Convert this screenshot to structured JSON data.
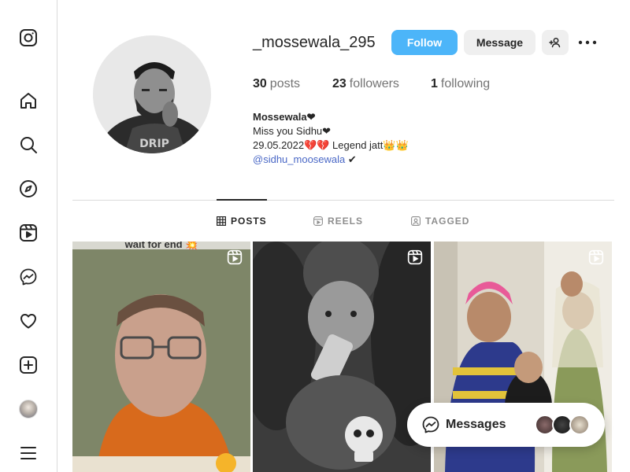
{
  "profile": {
    "username": "_mossewala_295",
    "follow_label": "Follow",
    "message_label": "Message",
    "stats": {
      "posts_count": "30",
      "posts_label": "posts",
      "followers_count": "23",
      "followers_label": "followers",
      "following_count": "1",
      "following_label": "following"
    },
    "bio": {
      "name": "Mossewala❤",
      "line1": "Miss you Sidhu❤",
      "line2": "29.05.2022💔💔 Legend jatt👑👑",
      "link": "@sidhu_moosewala",
      "link_suffix": " ✔"
    }
  },
  "tabs": [
    {
      "label": "POSTS",
      "active": true
    },
    {
      "label": "REELS",
      "active": false
    },
    {
      "label": "TAGGED",
      "active": false
    }
  ],
  "posts": [
    {
      "caption": "wait for end 💥",
      "type": "reel"
    },
    {
      "caption": "",
      "type": "reel"
    },
    {
      "caption": "",
      "type": "reel"
    }
  ],
  "messages": {
    "label": "Messages"
  },
  "colors": {
    "follow_button": "#4cb5f9",
    "link": "#4a68c6",
    "secondary_button": "#efefef"
  },
  "sidebar_icons": [
    "instagram-icon",
    "home-icon",
    "search-icon",
    "explore-icon",
    "reels-icon",
    "messenger-icon",
    "heart-icon",
    "create-icon",
    "profile-avatar",
    "menu-icon"
  ]
}
